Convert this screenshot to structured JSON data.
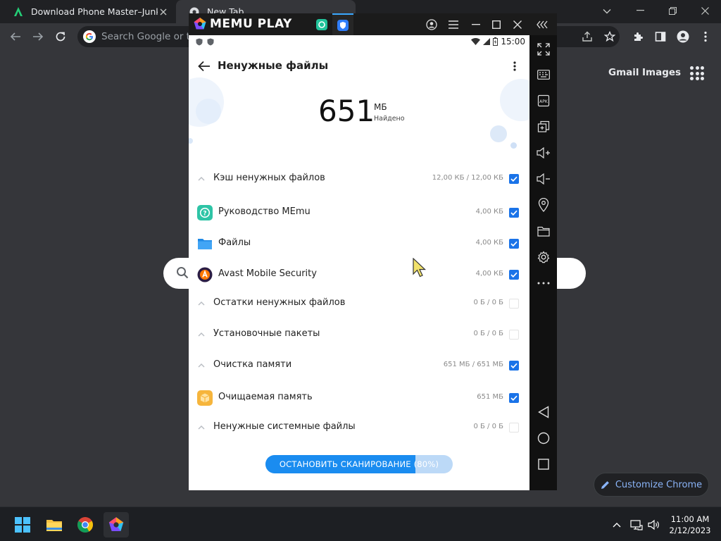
{
  "chrome": {
    "tabs": [
      {
        "title": "Download Phone Master–Junk C",
        "favicon": "apkpure-icon"
      },
      {
        "title": "New Tab",
        "favicon": "chrome-icon"
      }
    ],
    "omnibox_placeholder": "Search Google or type a URL",
    "ntp_links": {
      "gmail": "Gmail",
      "images": "Images"
    },
    "customize_label": "Customize Chrome"
  },
  "memu": {
    "logo_text": "MEMU PLAY",
    "accent": "#3aa8ff"
  },
  "android": {
    "status_time": "15:00",
    "title": "Ненужные файлы",
    "total": {
      "value": "651",
      "unit": "МБ",
      "caption": "Найдено"
    },
    "rows": [
      {
        "label": "Кэш ненужных файлов",
        "size": "12,00 КБ / 12,00 КБ",
        "checked": true,
        "kind": "group"
      },
      {
        "label": "Руководство MEmu",
        "size": "4,00 КБ",
        "checked": true,
        "kind": "app",
        "icon": "help-app-icon"
      },
      {
        "label": "Файлы",
        "size": "4,00 КБ",
        "checked": true,
        "kind": "app",
        "icon": "folder-app-icon"
      },
      {
        "label": "Avast Mobile Security",
        "size": "4,00 КБ",
        "checked": true,
        "kind": "app",
        "icon": "avast-app-icon"
      },
      {
        "label": "Остатки ненужных файлов",
        "size": "0 Б / 0 Б",
        "checked": false,
        "kind": "group"
      },
      {
        "label": "Установочные пакеты",
        "size": "0 Б / 0 Б",
        "checked": false,
        "kind": "group"
      },
      {
        "label": "Очистка памяти",
        "size": "651 МБ / 651 МБ",
        "checked": true,
        "kind": "group"
      },
      {
        "label": "Очищаемая память",
        "size": "651 МБ",
        "checked": true,
        "kind": "app",
        "icon": "memory-box-icon"
      },
      {
        "label": "Ненужные системные файлы",
        "size": "0 Б / 0 Б",
        "checked": false,
        "kind": "group"
      }
    ],
    "scan_button_label": "ОСТАНОВИТЬ СКАНИРОВАНИЕ (80%)",
    "scan_progress": 0.8,
    "accent": "#1a73e8"
  },
  "taskbar": {
    "time": "11:00 AM",
    "date": "2/12/2023"
  }
}
